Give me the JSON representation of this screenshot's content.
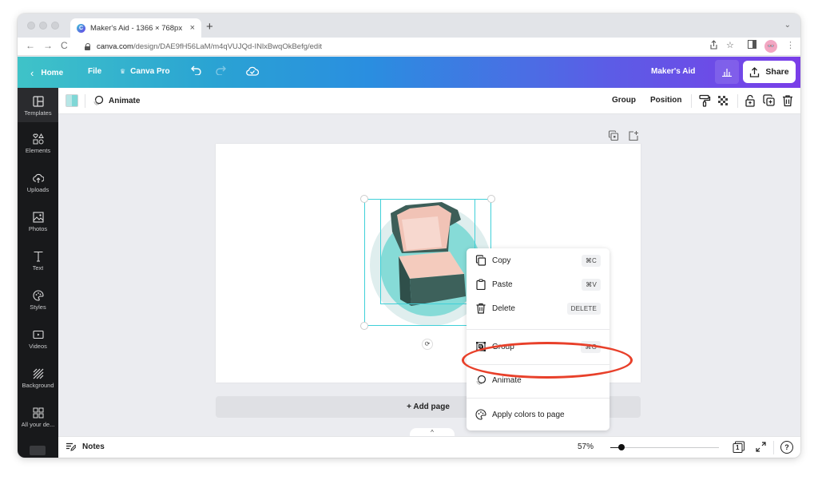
{
  "browser": {
    "tab_title": "Maker's Aid - 1366 × 768px",
    "tab_close": "×",
    "new_tab": "+",
    "tab_menu": "⌄",
    "url_domain": "canva.com",
    "url_path": "/design/DAE9fH56LaM/m4qVUJQd-INlxBwqOkBefg/edit",
    "favicon_letter": "C",
    "back": "←",
    "forward": "→",
    "reload": "C",
    "profile": "👓"
  },
  "header": {
    "home_label": "Home",
    "file_label": "File",
    "pro_label": "Canva Pro",
    "design_name": "Maker's Aid",
    "share_label": "Share"
  },
  "sidebar": {
    "items": [
      {
        "label": "Templates",
        "icon": "templates-icon"
      },
      {
        "label": "Elements",
        "icon": "elements-icon"
      },
      {
        "label": "Uploads",
        "icon": "uploads-icon"
      },
      {
        "label": "Photos",
        "icon": "photos-icon"
      },
      {
        "label": "Text",
        "icon": "text-icon"
      },
      {
        "label": "Styles",
        "icon": "styles-icon"
      },
      {
        "label": "Videos",
        "icon": "videos-icon"
      },
      {
        "label": "Background",
        "icon": "background-icon"
      },
      {
        "label": "All your de...",
        "icon": "all-designs-icon"
      }
    ]
  },
  "toolbar": {
    "animate_label": "Animate",
    "group_label": "Group",
    "position_label": "Position"
  },
  "canvas": {
    "add_page_label": "+ Add page",
    "collapse_label": "^"
  },
  "context_menu": {
    "items": [
      {
        "label": "Copy",
        "shortcut": "⌘C"
      },
      {
        "label": "Paste",
        "shortcut": "⌘V"
      },
      {
        "label": "Delete",
        "shortcut": "DELETE"
      },
      {
        "label": "Group",
        "shortcut": "⌘G"
      },
      {
        "label": "Animate",
        "shortcut": ""
      },
      {
        "label": "Apply colors to page",
        "shortcut": ""
      }
    ]
  },
  "bottom_bar": {
    "notes_label": "Notes",
    "zoom_label": "57%",
    "zoom_fraction": 0.1,
    "page_count": "1",
    "help": "?"
  },
  "colors": {
    "header_gradient_start": "#3fc3c8",
    "header_gradient_end": "#7a3ee8",
    "selection": "#3fd0d8",
    "annotation": "#e8402a",
    "sidebar_bg": "#18191b"
  }
}
